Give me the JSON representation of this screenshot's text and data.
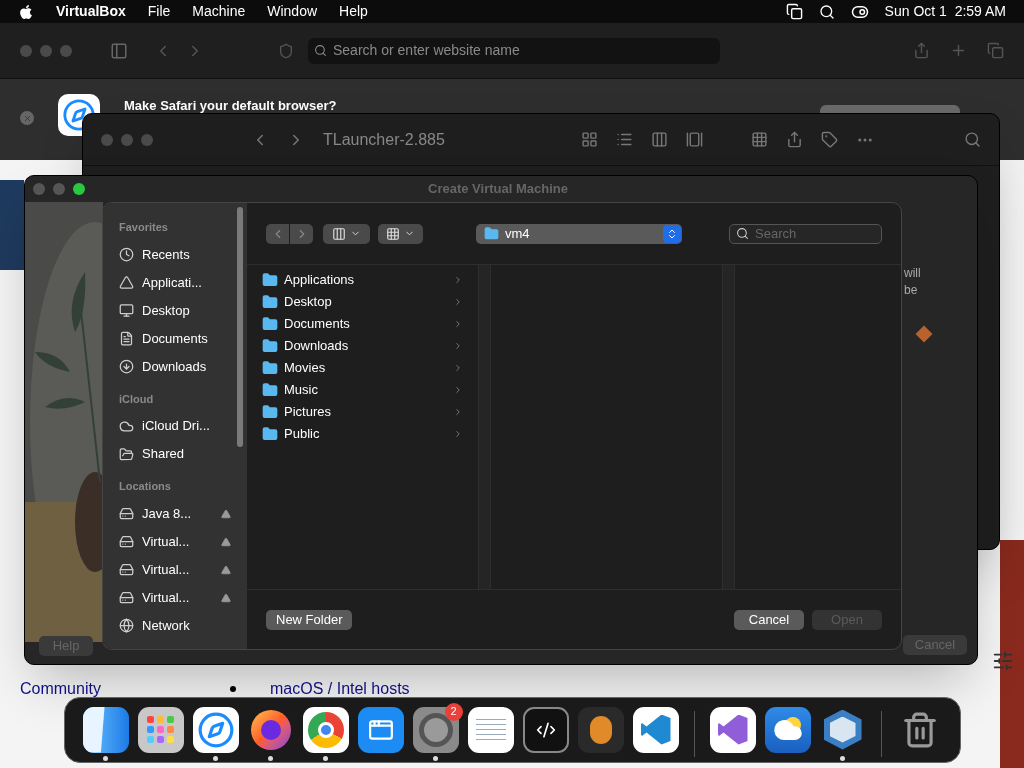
{
  "menubar": {
    "app": "VirtualBox",
    "menus": [
      "File",
      "Machine",
      "Window",
      "Help"
    ],
    "clock": "Sun Oct 1  2:59 AM"
  },
  "browser": {
    "search_placeholder": "Search or enter website name",
    "banner": "Make Safari your default browser?",
    "links": [
      "Community",
      "macOS / Intel hosts"
    ]
  },
  "finder": {
    "title": "TLauncher-2.885"
  },
  "vm_dialog": {
    "title": "Create Virtual Machine",
    "help": "Help",
    "cancel": "Cancel",
    "fragments": [
      "will",
      "be"
    ]
  },
  "open_panel": {
    "sidebar": [
      {
        "heading": "Favorites",
        "items": [
          {
            "label": "Recents",
            "kind": "clock",
            "eject": false
          },
          {
            "label": "Applicati...",
            "kind": "apps",
            "eject": false
          },
          {
            "label": "Desktop",
            "kind": "desktop",
            "eject": false
          },
          {
            "label": "Documents",
            "kind": "document",
            "eject": false
          },
          {
            "label": "Downloads",
            "kind": "download",
            "eject": false
          }
        ]
      },
      {
        "heading": "iCloud",
        "items": [
          {
            "label": "iCloud Dri...",
            "kind": "cloud",
            "eject": false
          },
          {
            "label": "Shared",
            "kind": "shared",
            "eject": false
          }
        ]
      },
      {
        "heading": "Locations",
        "items": [
          {
            "label": "Java 8...",
            "kind": "disk",
            "eject": true
          },
          {
            "label": "Virtual...",
            "kind": "disk",
            "eject": true
          },
          {
            "label": "Virtual...",
            "kind": "disk",
            "eject": true
          },
          {
            "label": "Virtual...",
            "kind": "disk",
            "eject": true
          },
          {
            "label": "Network",
            "kind": "network",
            "eject": false
          }
        ]
      }
    ],
    "location": "vm4",
    "search_placeholder": "Search",
    "folders": [
      "Applications",
      "Desktop",
      "Documents",
      "Downloads",
      "Movies",
      "Music",
      "Pictures",
      "Public"
    ],
    "buttons": [
      {
        "label": "New Folder",
        "kind": "new_folder",
        "disabled": false
      },
      {
        "label": "Cancel",
        "kind": "cancel",
        "disabled": false
      },
      {
        "label": "Open",
        "kind": "open",
        "disabled": true
      }
    ]
  },
  "dock": [
    {
      "kind": "finder",
      "running": true
    },
    {
      "kind": "launchpad",
      "running": false
    },
    {
      "kind": "safari",
      "running": true
    },
    {
      "kind": "firefox",
      "running": true
    },
    {
      "kind": "chrome",
      "running": true
    },
    {
      "kind": "appstore",
      "running": false
    },
    {
      "kind": "settings",
      "running": true,
      "badge": "2"
    },
    {
      "kind": "textedit",
      "running": false
    },
    {
      "kind": "terminal",
      "running": false
    },
    {
      "kind": "garageband",
      "running": false
    },
    {
      "kind": "vscode",
      "running": false
    },
    {
      "kind": "separator"
    },
    {
      "kind": "visualstudio",
      "running": false
    },
    {
      "kind": "weather",
      "running": false
    },
    {
      "kind": "virtualbox",
      "running": true
    },
    {
      "kind": "separator"
    },
    {
      "kind": "trash",
      "running": false
    }
  ]
}
